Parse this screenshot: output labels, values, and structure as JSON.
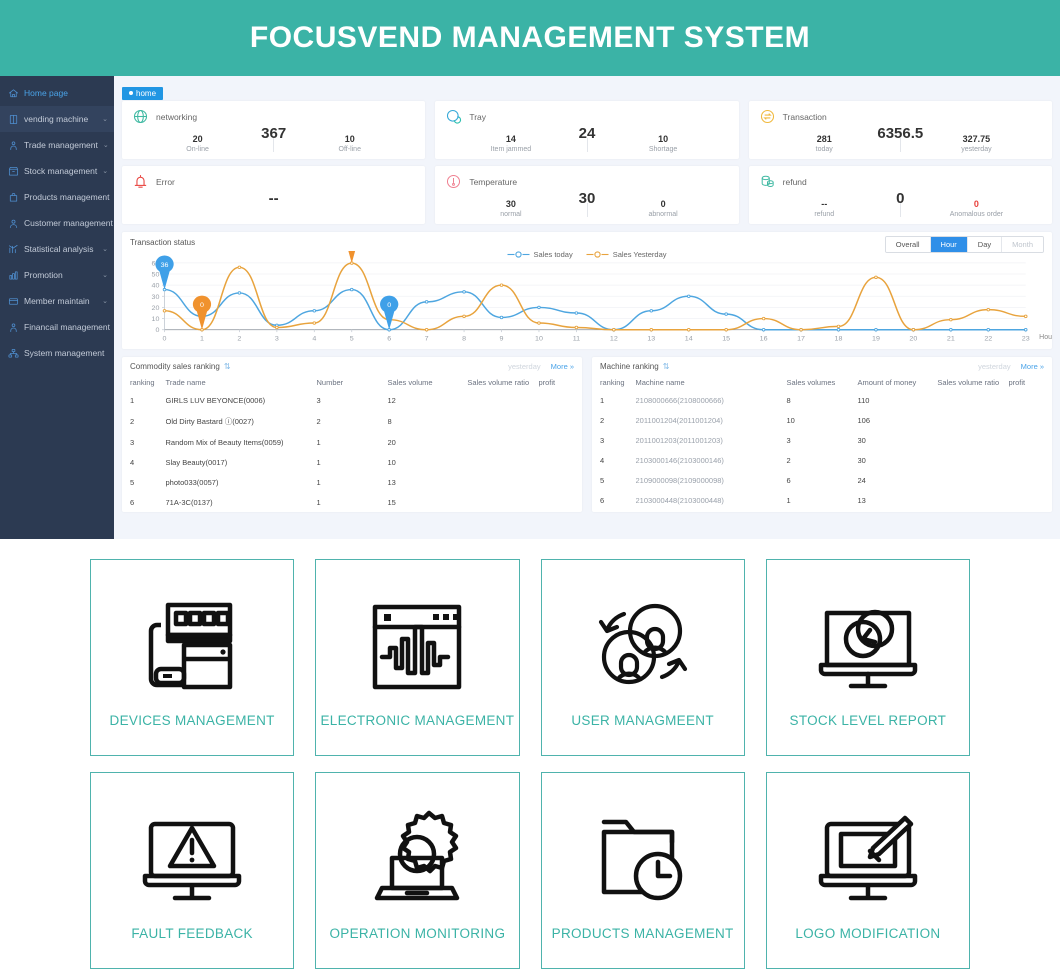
{
  "header": {
    "title": "FOCUSVEND MANAGEMENT SYSTEM",
    "bg": "#3bb3a6"
  },
  "tab": {
    "label": "home"
  },
  "sidebar": {
    "items": [
      {
        "label": "Home page",
        "icon": "home-icon",
        "caret": ""
      },
      {
        "label": "vending machine",
        "icon": "vending-machine-icon",
        "caret": "⌄"
      },
      {
        "label": "Trade management",
        "icon": "trade-icon",
        "caret": "⌄"
      },
      {
        "label": "Stock management",
        "icon": "stock-icon",
        "caret": "⌄"
      },
      {
        "label": "Products management",
        "icon": "products-icon",
        "caret": ""
      },
      {
        "label": "Customer management",
        "icon": "customer-icon",
        "caret": ""
      },
      {
        "label": "Statistical analysis",
        "icon": "statistics-icon",
        "caret": "⌄"
      },
      {
        "label": "Promotion",
        "icon": "promotion-icon",
        "caret": "⌄"
      },
      {
        "label": "Member maintain",
        "icon": "member-icon",
        "caret": "⌄"
      },
      {
        "label": "Financail management",
        "icon": "finance-icon",
        "caret": ""
      },
      {
        "label": "System management",
        "icon": "system-icon",
        "caret": ""
      }
    ]
  },
  "cards": [
    {
      "title": "networking",
      "icon": "globe-icon",
      "main": "367",
      "left_value": "20",
      "left_label": "On-line",
      "right_value": "10",
      "right_label": "Off-line",
      "right_red": false
    },
    {
      "title": "Error",
      "icon": "alarm-icon",
      "main": "--",
      "left_value": "",
      "left_label": "",
      "right_value": "",
      "right_label": "",
      "right_red": false
    },
    {
      "title": "Tray",
      "icon": "tray-icon",
      "main": "24",
      "left_value": "14",
      "left_label": "Item jammed",
      "right_value": "10",
      "right_label": "Shortage",
      "right_red": false
    },
    {
      "title": "Temperature",
      "icon": "thermometer-icon",
      "main": "30",
      "left_value": "30",
      "left_label": "normal",
      "right_value": "0",
      "right_label": "abnormal",
      "right_red": false
    },
    {
      "title": "Transaction",
      "icon": "transaction-icon",
      "main": "6356.5",
      "left_value": "281",
      "left_label": "today",
      "right_value": "327.75",
      "right_label": "yesterday",
      "right_red": false
    },
    {
      "title": "refund",
      "icon": "refund-icon",
      "main": "0",
      "left_value": "--",
      "left_label": "refund",
      "right_value": "0",
      "right_label": "Anomalous order",
      "right_red": true
    }
  ],
  "chart_panel": {
    "title": "Transaction status",
    "segments": [
      {
        "label": "Overall",
        "state": "normal"
      },
      {
        "label": "Hour",
        "state": "on"
      },
      {
        "label": "Day",
        "state": "normal"
      },
      {
        "label": "Month",
        "state": "off"
      }
    ],
    "axis_note": "Hou"
  },
  "chart_data": {
    "type": "line",
    "title": "Transaction status",
    "xlabel": "Hou",
    "ylabel": "",
    "x": [
      0,
      1,
      2,
      3,
      4,
      5,
      6,
      7,
      8,
      9,
      10,
      11,
      12,
      13,
      14,
      15,
      16,
      17,
      18,
      19,
      20,
      21,
      22,
      23
    ],
    "xticklabels": [
      "0",
      "1",
      "2",
      "3",
      "4",
      "5",
      "6",
      "7",
      "8",
      "9",
      "10",
      "11",
      "12",
      "13",
      "14",
      "15",
      "16",
      "17",
      "18",
      "19",
      "20",
      "21",
      "22",
      "23"
    ],
    "yticklabels": [
      "0",
      "10",
      "20",
      "30",
      "40",
      "50",
      "60"
    ],
    "ylim": [
      0,
      62
    ],
    "grid": true,
    "legend_position": "top-center",
    "series": [
      {
        "name": "Sales today",
        "color": "#4ea6e0",
        "values": [
          36,
          12,
          33,
          4,
          17,
          36,
          0,
          25,
          34,
          11,
          20,
          15,
          0,
          17,
          30,
          14,
          0,
          0,
          0,
          0,
          0,
          0,
          0,
          0
        ]
      },
      {
        "name": "Sales Yesterday",
        "color": "#e8a33d",
        "values": [
          17,
          0,
          56,
          2,
          6,
          59.75,
          9,
          0,
          12,
          40,
          6,
          2,
          0,
          0,
          0,
          0,
          10,
          0,
          3,
          47,
          0,
          9,
          18,
          12
        ]
      }
    ],
    "annotations": [
      {
        "series": "Sales today",
        "x": 0,
        "value": "36",
        "color": "#3fa0e8"
      },
      {
        "series": "Sales Yesterday",
        "x": 1,
        "value": "0",
        "color": "#f5a game"
      },
      {
        "series": "Sales Yesterday",
        "x": 5,
        "value": "59.75",
        "color": "#f0922e"
      },
      {
        "series": "Sales today",
        "x": 6,
        "value": "0",
        "color": "#3fa0e8"
      }
    ]
  },
  "commodity_table": {
    "title": "Commodity sales ranking",
    "ghost_label": "yesterday",
    "more_label": "More »",
    "columns": [
      "ranking",
      "Trade name",
      "Number",
      "Sales volume",
      "Sales volume ratio",
      "profit"
    ],
    "rows": [
      [
        "1",
        "GIRLS LUV BEYONCE(0006)",
        "3",
        "12",
        "",
        ""
      ],
      [
        "2",
        "Old Dirty Bastard ⓘ(0027)",
        "2",
        "8",
        "",
        ""
      ],
      [
        "3",
        "Random Mix of Beauty Items(0059)",
        "1",
        "20",
        "",
        ""
      ],
      [
        "4",
        "Slay Beauty(0017)",
        "1",
        "10",
        "",
        ""
      ],
      [
        "5",
        "photo033(0057)",
        "1",
        "13",
        "",
        ""
      ],
      [
        "6",
        "71A-3C(0137)",
        "1",
        "15",
        "",
        ""
      ]
    ]
  },
  "machine_table": {
    "title": "Machine ranking",
    "ghost_label": "yesterday",
    "more_label": "More »",
    "columns": [
      "ranking",
      "Machine name",
      "Sales volumes",
      "Amount of money",
      "Sales volume ratio",
      "profit"
    ],
    "rows": [
      [
        "1",
        "2108000666(2108000666)",
        "8",
        "110",
        "",
        ""
      ],
      [
        "2",
        "2011001204(2011001204)",
        "10",
        "106",
        "",
        ""
      ],
      [
        "3",
        "2011001203(2011001203)",
        "3",
        "30",
        "",
        ""
      ],
      [
        "4",
        "2103000146(2103000146)",
        "2",
        "30",
        "",
        ""
      ],
      [
        "5",
        "2109000098(2109000098)",
        "6",
        "24",
        "",
        ""
      ],
      [
        "6",
        "2103000448(2103000448)",
        "1",
        "13",
        "",
        ""
      ]
    ]
  },
  "tiles": [
    {
      "label": "DEVICES MANAGEMENT",
      "icon": "vending-device-icon"
    },
    {
      "label": "ELECTRONIC MANAGEMENT",
      "icon": "waveform-window-icon"
    },
    {
      "label": "USER MANAGMEENT",
      "icon": "users-sync-icon"
    },
    {
      "label": "STOCK LEVEL REPORT",
      "icon": "monitor-chart-icon"
    },
    {
      "label": "FAULT FEEDBACK",
      "icon": "monitor-warning-icon"
    },
    {
      "label": "OPERATION MONITORING",
      "icon": "gear-laptop-icon"
    },
    {
      "label": "PRODUCTS MANAGEMENT",
      "icon": "folder-clock-icon"
    },
    {
      "label": "LOGO MODIFICATION",
      "icon": "monitor-brush-icon"
    }
  ],
  "colors": {
    "accent": "#3bb3a6",
    "sidebar": "#2c3a52",
    "blue": "#2f8fe8",
    "today": "#4ea6e0",
    "yesterday": "#e8a33d"
  }
}
